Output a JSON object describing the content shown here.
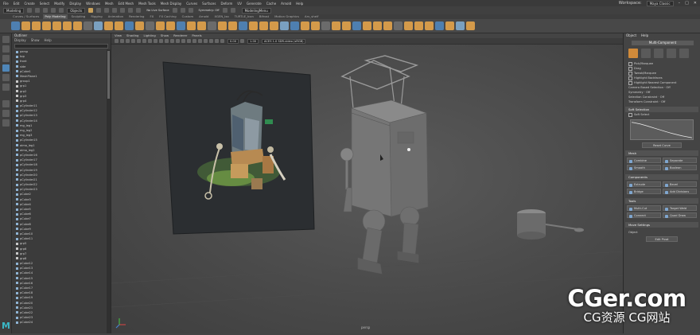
{
  "menubar": {
    "items": [
      "File",
      "Edit",
      "Create",
      "Select",
      "Modify",
      "Display",
      "Windows",
      "Mesh",
      "Edit Mesh",
      "Mesh Tools",
      "Mesh Display",
      "Curves",
      "Surfaces",
      "Deform",
      "UV",
      "Generate",
      "Cache",
      "Arnold",
      "Help"
    ],
    "workspace_label": "Workspace:",
    "workspace_value": "Maya Classic",
    "window_controls": [
      "–",
      "□",
      "✕"
    ]
  },
  "statusline": {
    "mode": "Modeling",
    "objects": "Objects",
    "no_live": "No Live Surface",
    "symmetry": "Symmetry: Off",
    "panel_menu": "ModelingMenu"
  },
  "shelf_tabs": [
    "Curves / Surfaces",
    "Poly Modeling",
    "Sculpting",
    "Rigging",
    "Animation",
    "Rendering",
    "FX",
    "FX Caching",
    "Custom",
    "Arnold",
    "XGEN_Ixo",
    "TURTLE_Icon",
    "Bifrost",
    "Motion Graphics",
    "Arv_shelf"
  ],
  "shelf_active": "Poly Modeling",
  "outliner": {
    "title": "Outliner",
    "menu": [
      "Display",
      "Show",
      "Help"
    ],
    "rows": [
      "persp",
      "top",
      "front",
      "side",
      "pCube1",
      "MeshPlane1",
      "group1",
      "grp1",
      "grp2",
      "grp3",
      "grp4",
      "pCylinder11",
      "pCylinder12",
      "pCylinder13",
      "pCylinder14",
      "mg_leg1",
      "mg_leg2",
      "mg_leg3",
      "pCylinder15",
      "aimo_leg1",
      "aimo_leg2",
      "pCylinder16",
      "pCylinder17",
      "pCylinder18",
      "pCylinder19",
      "pCylinder20",
      "pCylinder21",
      "pCylinder22",
      "pCylinder23",
      "pCube2",
      "pCube3",
      "pCube4",
      "pCube5",
      "pCube6",
      "pCube7",
      "pCube8",
      "pCube9",
      "pCube10",
      "pCube11",
      "grp5",
      "grp6",
      "grp7",
      "grp8",
      "pCube12",
      "pCube13",
      "pCube14",
      "pCube15",
      "pCube16",
      "pCube17",
      "pCube18",
      "pCube19",
      "pCube20",
      "pCube21",
      "pCube22",
      "pCube23",
      "pCube24"
    ]
  },
  "viewport": {
    "menu": [
      "View",
      "Shading",
      "Lighting",
      "Show",
      "Renderer",
      "Panels"
    ],
    "field_a": "0.00",
    "field_b": "1.00",
    "colorspace": "ACES 1.0 SDR-video (sRGB)",
    "camera": "persp"
  },
  "attr": {
    "tabs": [
      "Object",
      "Help"
    ],
    "multi_component": "Multi-Component",
    "options": [
      "Pick/Marquee",
      "Drag",
      "Tweak/Marquee",
      "Highlight Backfaces",
      "Highlight Nearest Component"
    ],
    "camera_select": "Camera Based Selection",
    "symmetry": "Symmetry",
    "selection_constraint": "Selection Constraint",
    "transform_constraint": "Transform Constraint",
    "off": "Off",
    "soft_selection": "Soft Selection",
    "soft_select_label": "Soft Select",
    "reset_curve": "Reset Curve",
    "mesh": "Mesh",
    "mesh_buttons": [
      "Combine",
      "Separate",
      "Smooth",
      "Boolean"
    ],
    "components": "Components",
    "comp_buttons": [
      "Extrude",
      "Bevel",
      "Bridge",
      "Add Divisions"
    ],
    "tools": "Tools",
    "tool_buttons": [
      "Multi-Cut",
      "Target Weld",
      "Connect",
      "Quad Draw"
    ],
    "move_settings": "Move Settings",
    "object_label": "Object",
    "edit_pivot": "Edit Pivot"
  },
  "watermark": {
    "line1": "CGer.com",
    "line2": "CG资源 CG网站"
  },
  "logo": "M",
  "colors": {
    "accent_orange": "#d08a3a",
    "selection_blue": "#4f86b8",
    "maya_teal": "#3ab7c6"
  }
}
